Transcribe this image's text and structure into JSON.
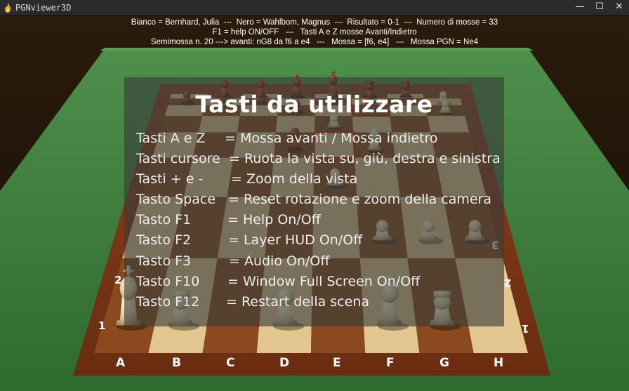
{
  "window": {
    "title": "PGNviewer3D",
    "controls": {
      "minimize": "—",
      "maximize": "☐",
      "close": "✕"
    }
  },
  "info": {
    "line1": "Bianco = Bernhard, Julia  ---  Nero = Wahlbom, Magnus  ---  Risultato = 0-1  ---  Numero di mosse = 33",
    "line2": "F1 = help ON/OFF   ---   Tasti A e Z mosse Avanti/Indietro",
    "line3": "Semimossa n. 20 ---> avanti: nG8 da f6 a e4   ---   Mossa = [f6, e4]   ---   Mossa PGN = Ne4"
  },
  "help": {
    "title": "Tasti da utilizzare",
    "rows": [
      {
        "key": "Tasti A e Z",
        "desc": "= Mossa avanti / Mossa indietro"
      },
      {
        "key": "Tasti cursore",
        "desc": "= Ruota la vista su, giù, destra e sinistra"
      },
      {
        "key": "Tasti + e -",
        "desc": "= Zoom della vista"
      },
      {
        "key": "Tasto Space",
        "desc": "= Reset rotazione e zoom della camera"
      },
      {
        "key": "Tasto F1",
        "desc": "= Help On/Off"
      },
      {
        "key": "Tasto F2",
        "desc": "= Layer HUD On/Off"
      },
      {
        "key": "Tasto F3",
        "desc": "= Audio On/Off"
      },
      {
        "key": "Tasto F10",
        "desc": "= Window Full Screen On/Off"
      },
      {
        "key": "Tasto F12",
        "desc": "= Restart della scena"
      }
    ]
  },
  "board": {
    "files": [
      "A",
      "B",
      "C",
      "D",
      "E",
      "F",
      "G",
      "H"
    ],
    "ranks": [
      "1",
      "2",
      "3"
    ],
    "colors": {
      "table": "#3f7f3f",
      "frame": "#7a3518",
      "light": "#e3c68e",
      "dark": "#8a4a1e",
      "white_piece": "#d8c8a0",
      "black_piece": "#6a2c10",
      "highlight": "#cc1111"
    }
  }
}
